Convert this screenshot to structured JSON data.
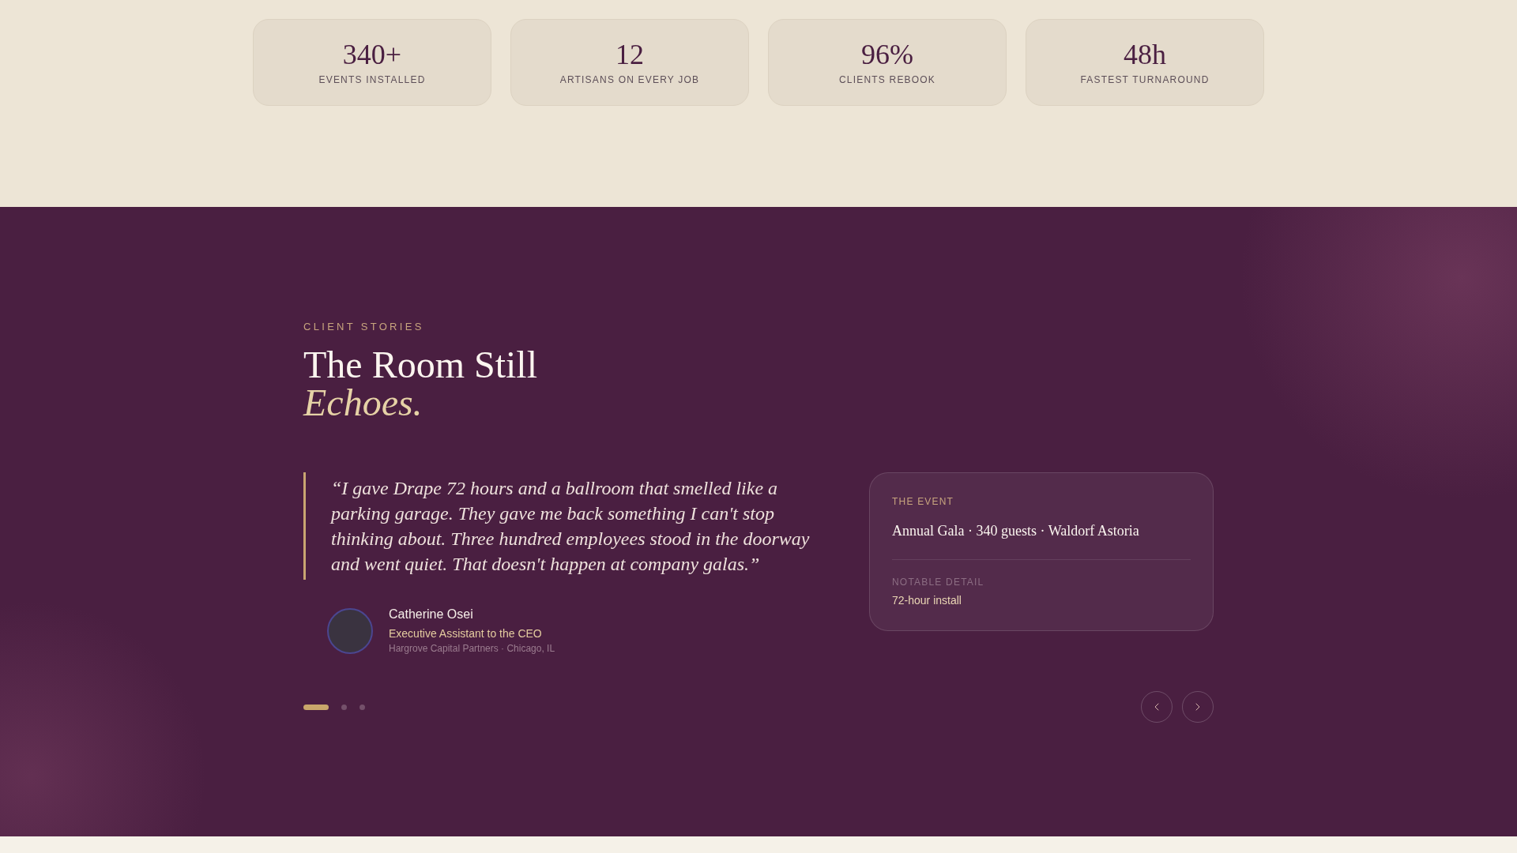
{
  "stats": [
    {
      "value": "340+",
      "label": "EVENTS INSTALLED"
    },
    {
      "value": "12",
      "label": "ARTISANS ON EVERY JOB"
    },
    {
      "value": "96%",
      "label": "CLIENTS REBOOK"
    },
    {
      "value": "48h",
      "label": "FASTEST TURNAROUND"
    }
  ],
  "client_stories": {
    "eyebrow": "CLIENT STORIES",
    "title": "The Room Still",
    "title_accent": "Echoes.",
    "quote": "“I gave Drape 72 hours and a ballroom that smelled like a parking garage. They gave me back something I can't stop thinking about. Three hundred employees stood in the doorway and went quiet. That doesn't happen at company galas.”",
    "author": {
      "name": "Catherine Osei",
      "role": "Executive Assistant to the CEO",
      "company": "Hargrove Capital Partners · Chicago, IL"
    },
    "event_card": {
      "label": "THE EVENT",
      "value": "Annual Gala · 340 guests · Waldorf Astoria",
      "detail_label": "NOTABLE DETAIL",
      "detail_value": "72-hour install"
    },
    "pagination": [
      {
        "selected": true
      },
      {
        "selected": false
      },
      {
        "selected": false
      }
    ]
  }
}
